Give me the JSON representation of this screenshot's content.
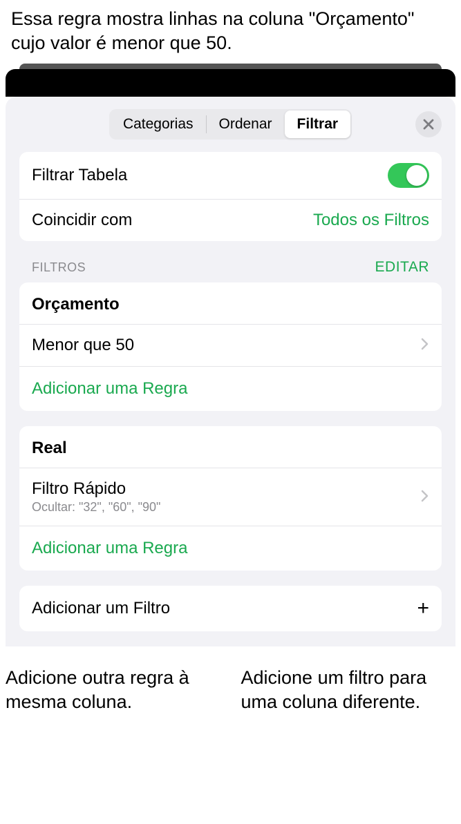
{
  "annotations": {
    "top": "Essa regra mostra linhas na coluna \"Orçamento\" cujo valor é menor que 50.",
    "bottom_left": "Adicione outra regra à mesma coluna.",
    "bottom_right": "Adicione um filtro para uma coluna diferente."
  },
  "tabs": {
    "categories": "Categorias",
    "sort": "Ordenar",
    "filter": "Filtrar"
  },
  "filter_panel": {
    "filter_table_label": "Filtrar Tabela",
    "match_label": "Coincidir com",
    "match_value": "Todos os Filtros"
  },
  "section": {
    "title": "FILTROS",
    "edit": "EDITAR"
  },
  "group1": {
    "title": "Orçamento",
    "rule": "Menor que 50",
    "add_rule": "Adicionar uma Regra"
  },
  "group2": {
    "title": "Real",
    "rule_title": "Filtro Rápido",
    "rule_sub": "Ocultar: \"32\", \"60\", \"90\"",
    "add_rule": "Adicionar uma Regra"
  },
  "add_filter": {
    "label": "Adicionar um Filtro"
  }
}
